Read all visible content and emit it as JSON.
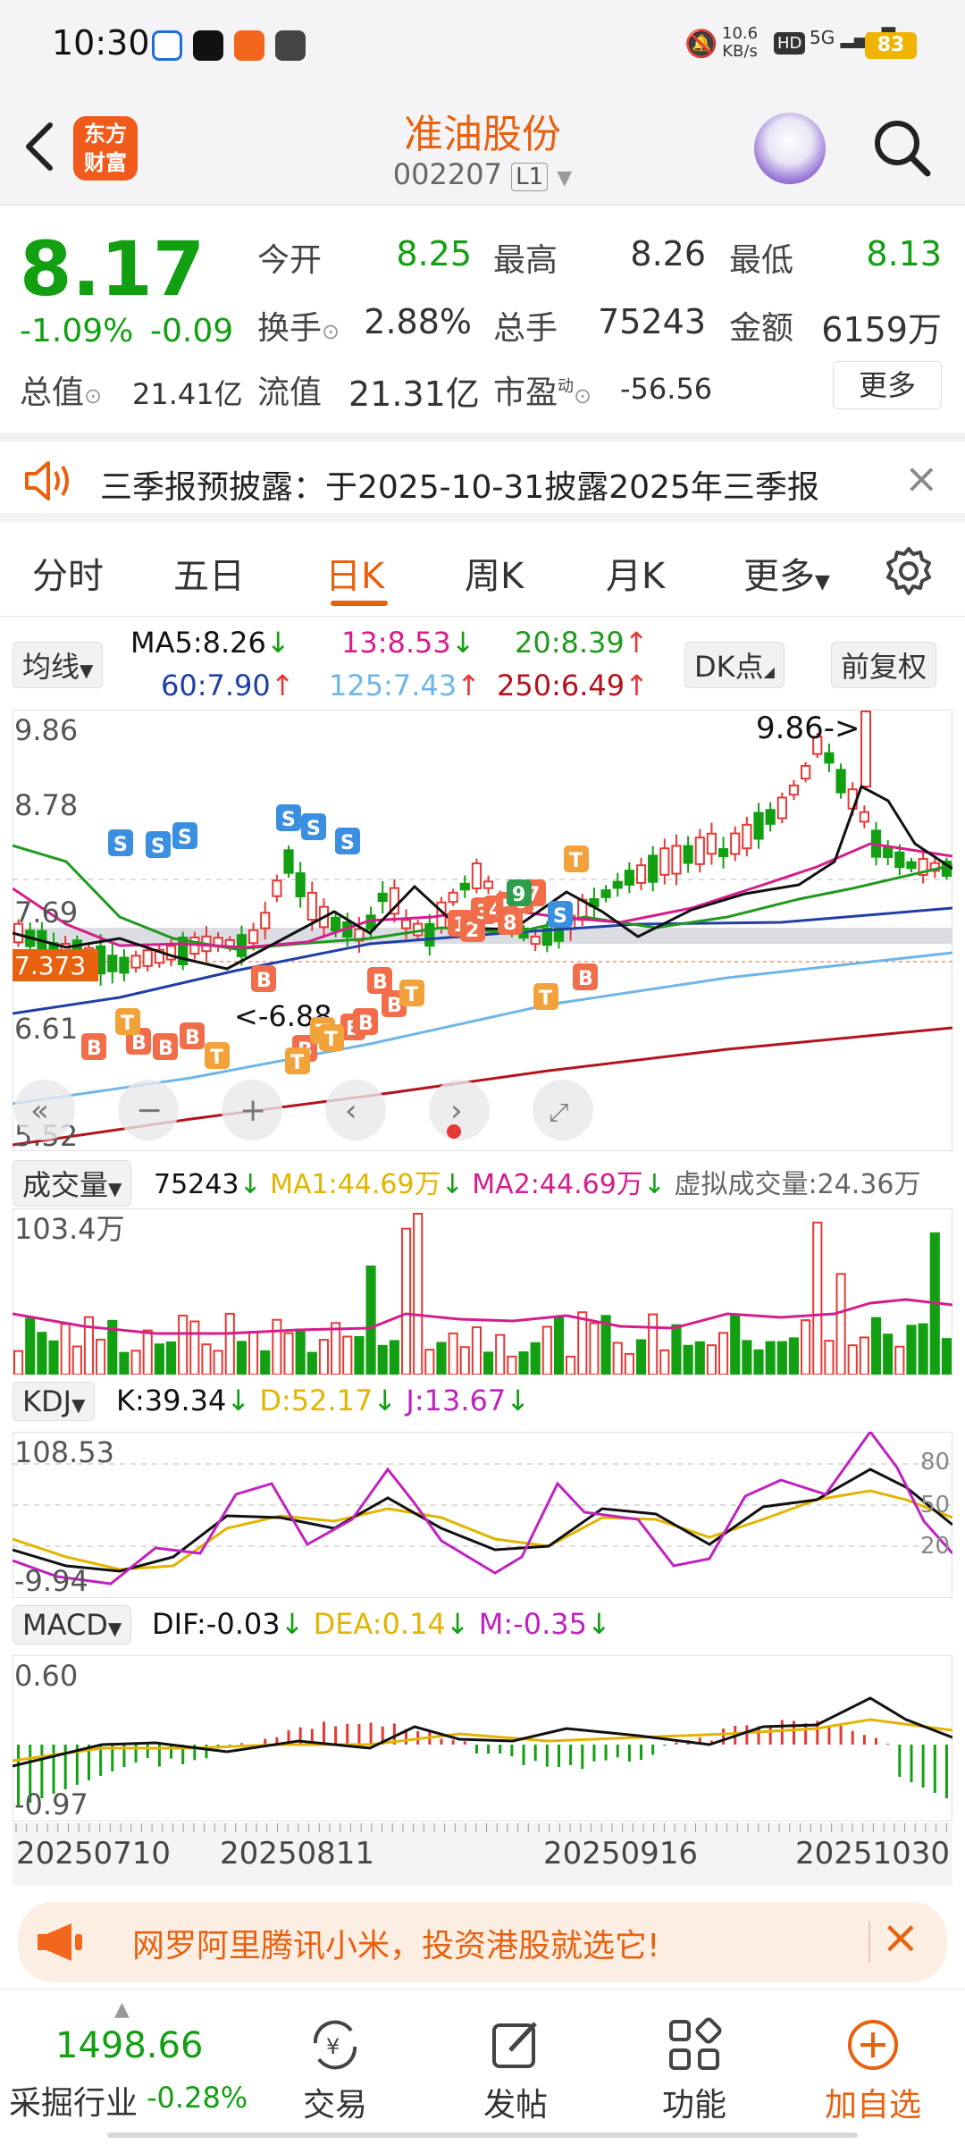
{
  "status": {
    "time": "10:30",
    "net_speed_top": "10.6",
    "net_speed_bottom": "KB/s",
    "hd": "HD",
    "signal": "5G",
    "battery": "83"
  },
  "header": {
    "logo_top": "东方",
    "logo_bottom": "财富",
    "stock_name": "准油股份",
    "stock_code": "002207",
    "level": "L1"
  },
  "quote": {
    "price": "8.17",
    "change_pct": "-1.09%",
    "change": "-0.09",
    "open_label": "今开",
    "open": "8.25",
    "high_label": "最高",
    "high": "8.26",
    "low_label": "最低",
    "low": "8.13",
    "turnover_label": "换手",
    "turnover": "2.88%",
    "volume_label": "总手",
    "volume": "75243",
    "amount_label": "金额",
    "amount": "6159万",
    "mcap_label": "总值",
    "mcap": "21.41亿",
    "float_label": "流值",
    "float": "21.31亿",
    "pe_label": "市盈",
    "pe_sup": "动",
    "pe": "-56.56",
    "more_label": "更多"
  },
  "notice": {
    "text": "三季报预披露：于2025-10-31披露2025年三季报"
  },
  "tabs": [
    "分时",
    "五日",
    "日K",
    "周K",
    "月K",
    "更多"
  ],
  "active_tab": "日K",
  "ma": {
    "selector": "均线",
    "ma5": "MA5:8.26",
    "ma13": "13:8.53",
    "ma20": "20:8.39",
    "ma60": "60:7.90",
    "ma125": "125:7.43",
    "ma250": "250:6.49",
    "dk": "DK点",
    "adjust": "前复权"
  },
  "kline": {
    "y_top": "9.86",
    "y_2": "8.78",
    "y_3": "7.69",
    "y_4": "6.61",
    "y_bottom": "5.52",
    "high_note": "9.86->",
    "low_note": "<-6.88",
    "last_price_tag": "7.373"
  },
  "volume": {
    "selector": "成交量",
    "value": "75243",
    "ma1": "MA1:44.69万",
    "ma2": "MA2:44.69万",
    "virtual": "虚拟成交量:24.36万",
    "y_top": "103.4万"
  },
  "kdj": {
    "selector": "KDJ",
    "k": "K:39.34",
    "d": "D:52.17",
    "j": "J:13.67",
    "y_top": "108.53",
    "y_bottom": "-9.94",
    "l80": "80",
    "l50": "50",
    "l20": "20"
  },
  "macd": {
    "selector": "MACD",
    "dif": "DIF:-0.03",
    "dea": "DEA:0.14",
    "m": "M:-0.35",
    "y_top": "0.60",
    "y_bottom": "-0.97"
  },
  "dates": [
    "20250710",
    "20250811",
    "20250916",
    "20251030"
  ],
  "ad": {
    "text": "网罗阿里腾讯小米，投资港股就选它!"
  },
  "bottom": {
    "index_value": "1498.66",
    "index_name": "采掘行业",
    "index_change": "-0.28%",
    "nav": [
      {
        "label": "交易",
        "icon": "trade-icon"
      },
      {
        "label": "发帖",
        "icon": "post-icon"
      },
      {
        "label": "功能",
        "icon": "function-icon"
      },
      {
        "label": "加自选",
        "icon": "add-watchlist-icon"
      }
    ]
  },
  "colors": {
    "up": "#e53935",
    "down": "#12a012",
    "accent": "#e8610f",
    "ma5": "#111111",
    "ma13": "#d61d8c",
    "ma20": "#1f9a1f",
    "ma60": "#1f3fa6",
    "ma125": "#6fb6e8",
    "ma250": "#b5121b"
  }
}
